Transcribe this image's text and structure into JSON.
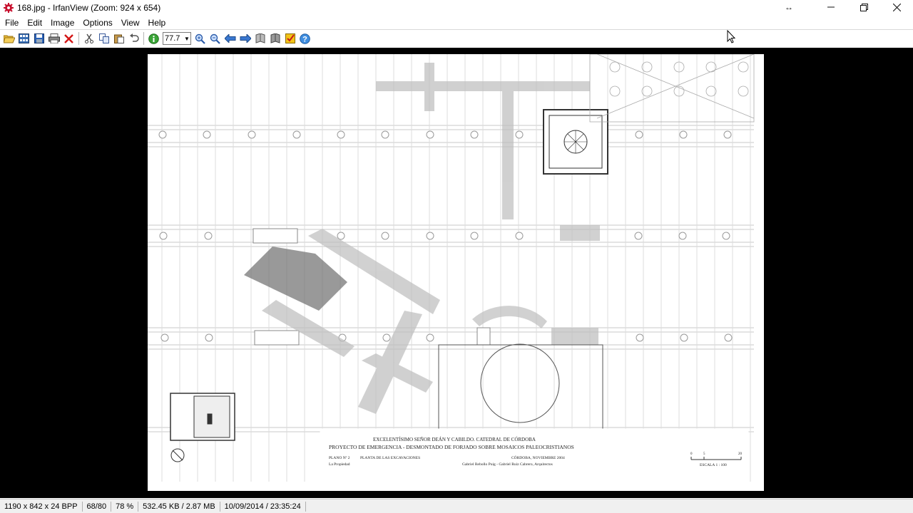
{
  "window": {
    "title": "168.jpg - IrfanView (Zoom: 924 x 654)",
    "controls": [
      "minimize",
      "maximize",
      "close"
    ]
  },
  "menu": {
    "items": [
      "File",
      "Edit",
      "Image",
      "Options",
      "View",
      "Help"
    ]
  },
  "toolbar": {
    "zoom_value": "77.7",
    "icons": [
      "open-folder-icon",
      "thumbnails-icon",
      "save-icon",
      "print-icon",
      "delete-icon",
      "cut-icon",
      "copy-icon",
      "paste-icon",
      "undo-icon",
      "info-icon",
      "zoom-in-icon",
      "zoom-out-icon",
      "previous-icon",
      "next-icon",
      "page-left-icon",
      "page-right-icon",
      "properties-icon",
      "help-icon"
    ]
  },
  "image": {
    "title_block": {
      "line1": "EXCELENTÍSIMO  SEÑOR  DEÁN  Y  CABILDO.  CATEDRAL  DE  CÓRDOBA",
      "line2": "PROYECTO DE EMERGENCIA - DESMONTADO DE FORJADO SOBRE MOSAICOS PALEOCRISTIANOS",
      "plano": "PLANO Nº 2",
      "plano_title": "PLANTA DE LAS EXCAVACIONES",
      "owner": "La Propiedad",
      "date": "CÓRDOBA,  NOVIEMBRE 2004",
      "architects": "Gabriel Rebollo Puig  -  Gabriel Ruiz Cabrero,  Arquitectos",
      "scale_label": "ESCALA  1 : 100",
      "scale_ticks": [
        "0",
        "5",
        "20"
      ]
    }
  },
  "status": {
    "dimensions": "1190 x 842 x 24 BPP",
    "index": "68/80",
    "zoom": "78 %",
    "size": "532.45 KB / 2.87 MB",
    "datetime": "10/09/2014 / 23:35:24"
  }
}
